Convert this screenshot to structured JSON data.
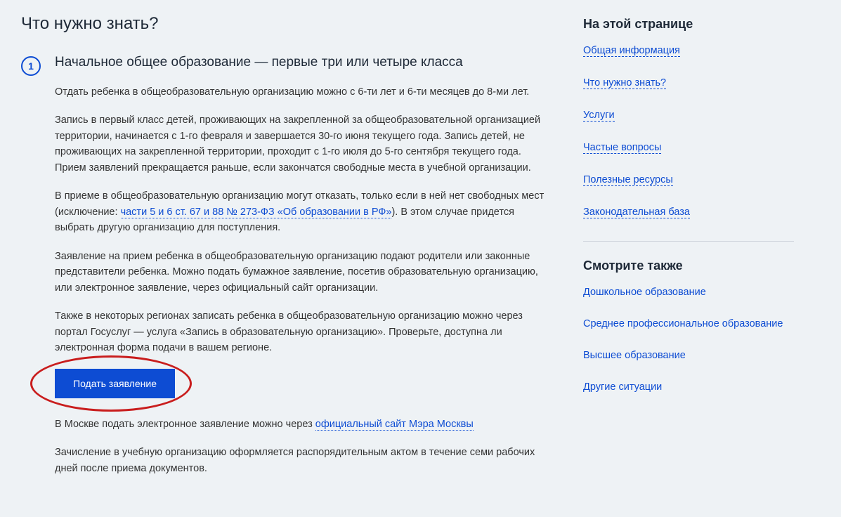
{
  "main": {
    "title": "Что нужно знать?",
    "section": {
      "number": "1",
      "heading": "Начальное общее образование — первые три или четыре класса",
      "p1": "Отдать ребенка в общеобразовательную организацию можно с 6-ти лет и 6-ти месяцев до 8-ми лет.",
      "p2": "Запись в первый класс детей, проживающих на закрепленной за общеобразовательной организацией территории, начинается с 1-го февраля и завершается 30-го июня текущего года. Запись детей, не проживающих на закрепленной территории, проходит с 1-го июля до 5-го сентября текущего года. Прием заявлений прекращается раньше, если закончатся свободные места в учебной организации.",
      "p3_before": "В приеме в общеобразовательную организацию могут отказать, только если в ней нет свободных мест (исключение: ",
      "p3_link": "части 5 и 6 ст. 67 и 88 № 273-ФЗ «Об образовании в РФ»",
      "p3_after": "). В этом случае придется выбрать другую организацию для поступления.",
      "p4": "Заявление на прием ребенка в общеобразовательную организацию подают родители или законные представители ребенка. Можно подать бумажное заявление, посетив образовательную организацию, или электронное заявление, через официальный сайт организации.",
      "p5": "Также в некоторых регионах записать ребенка в общеобразовательную организацию можно через портал Госуслуг — услуга «Запись в образовательную организацию». Проверьте, доступна ли электронная форма подачи в вашем регионе.",
      "button_label": "Подать заявление",
      "p6_before": "В Москве подать электронное заявление можно через ",
      "p6_link": "официальный сайт Мэра Москвы",
      "p7": "Зачисление в учебную организацию оформляется распорядительным актом в течение семи рабочих дней после приема документов."
    }
  },
  "sidebar": {
    "nav_heading": "На этой странице",
    "nav_links": [
      "Общая информация",
      "Что нужно знать?",
      "Услуги",
      "Частые вопросы",
      "Полезные ресурсы",
      "Законодательная база"
    ],
    "see_also_heading": "Смотрите также",
    "see_also_links": [
      "Дошкольное образование",
      "Среднее профессиональное образование",
      "Высшее образование",
      "Другие ситуации"
    ]
  }
}
